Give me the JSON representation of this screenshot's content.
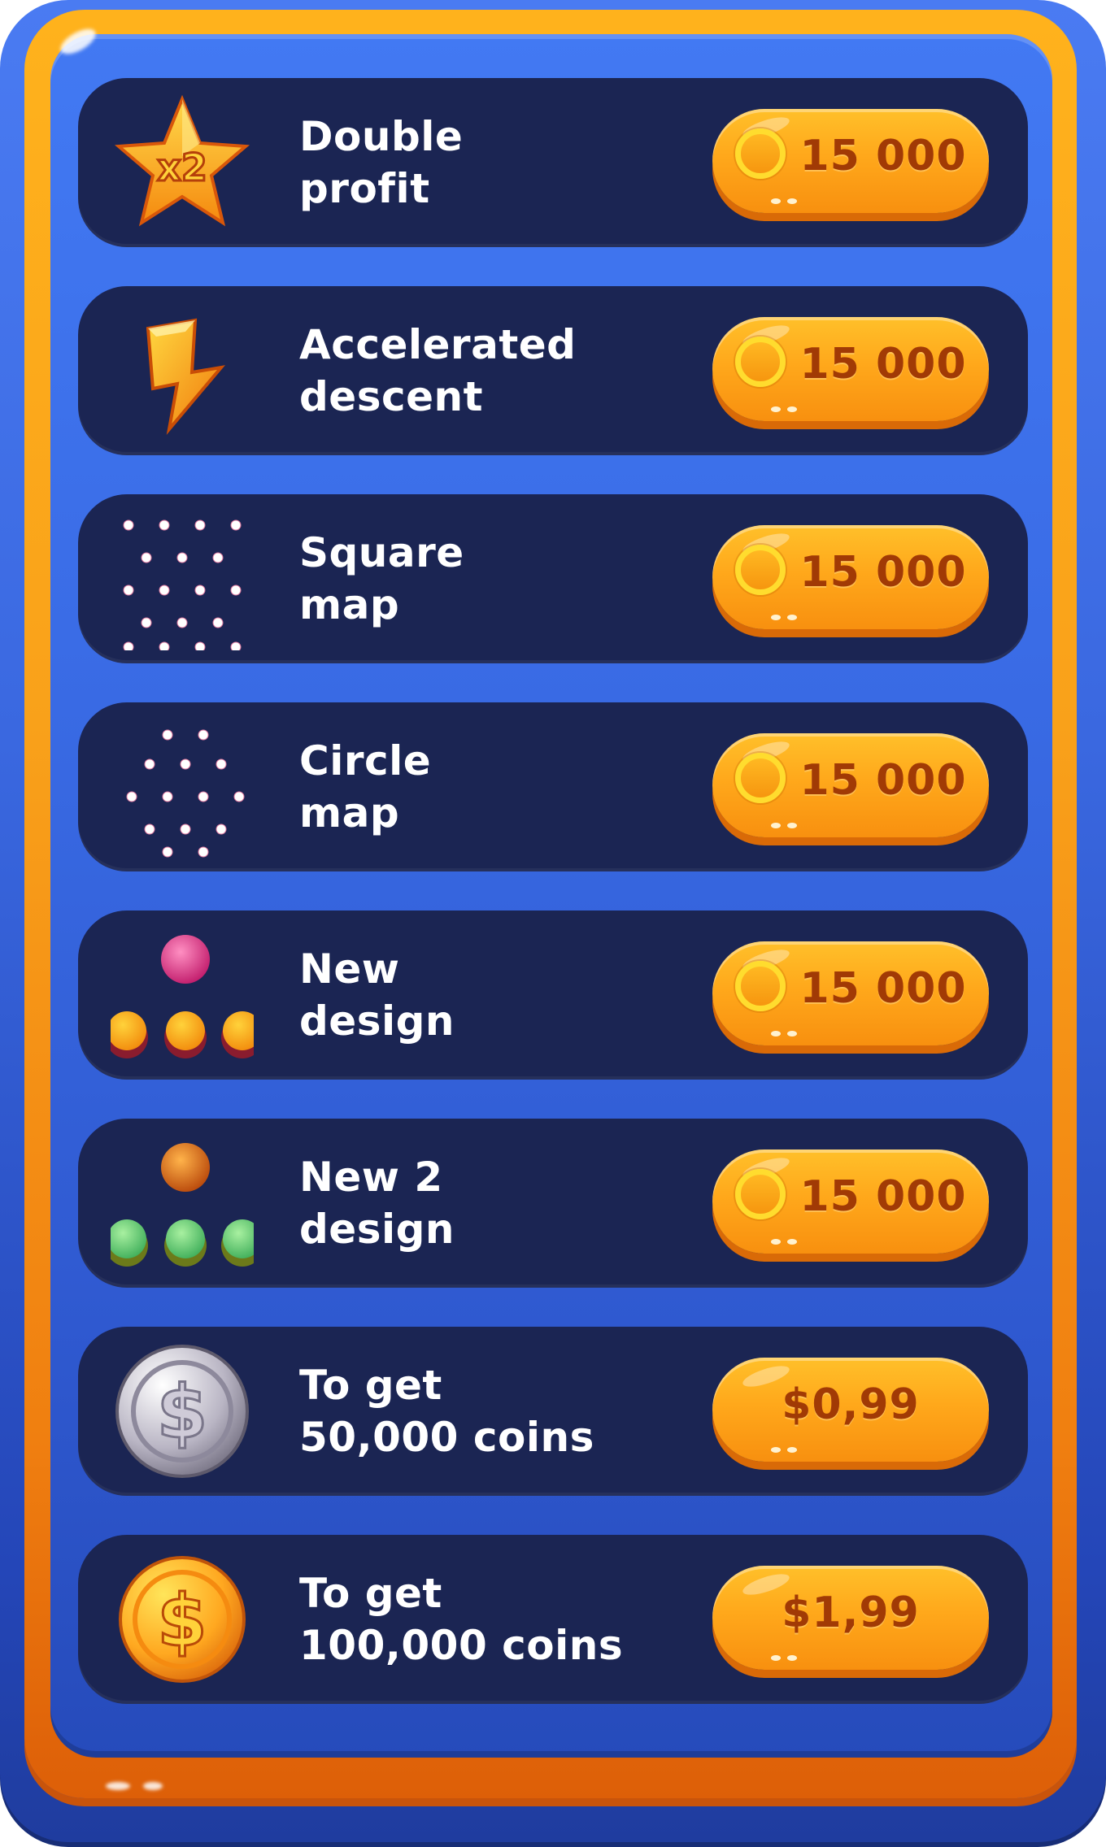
{
  "shop": {
    "items": [
      {
        "id": "double-profit",
        "icon": "x2-star-icon",
        "line1": "Double",
        "line2": "profit",
        "price": "15 000",
        "currency_icon": "coin-icon"
      },
      {
        "id": "accelerated-descent",
        "icon": "lightning-bolt-icon",
        "line1": "Accelerated",
        "line2": "descent",
        "price": "15 000",
        "currency_icon": "coin-icon"
      },
      {
        "id": "square-map",
        "icon": "square-dot-grid-icon",
        "line1": "Square",
        "line2": "map",
        "price": "15 000",
        "currency_icon": "coin-icon"
      },
      {
        "id": "circle-map",
        "icon": "circle-dot-grid-icon",
        "line1": "Circle",
        "line2": "map",
        "price": "15 000",
        "currency_icon": "coin-icon"
      },
      {
        "id": "new-design",
        "icon": "pink-orange-balls-icon",
        "line1": "New",
        "line2": "design",
        "price": "15 000",
        "currency_icon": "coin-icon"
      },
      {
        "id": "new-2-design",
        "icon": "orange-green-balls-icon",
        "line1": "New 2",
        "line2": "design",
        "price": "15 000",
        "currency_icon": "coin-icon"
      },
      {
        "id": "get-50000-coins",
        "icon": "silver-dollar-coin-icon",
        "line1": "To get",
        "line2": "50,000 coins",
        "price": "$0,99"
      },
      {
        "id": "get-100000-coins",
        "icon": "gold-dollar-coin-icon",
        "line1": "To get",
        "line2": "100,000 coins",
        "price": "$1,99"
      }
    ]
  },
  "colors": {
    "frame_blue": "#4279f3",
    "frame_orange": "#ffb21c",
    "row_bg": "#1b2553",
    "button_orange": "#ffa81b",
    "price_text": "#a13a05"
  }
}
